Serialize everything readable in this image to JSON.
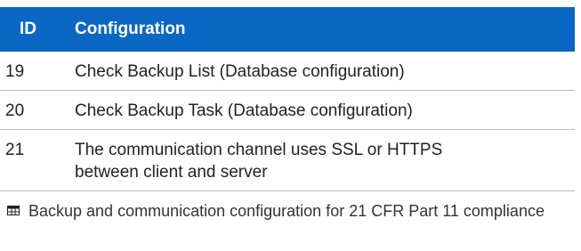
{
  "table": {
    "header": {
      "id_label": "ID",
      "config_label": "Configuration"
    },
    "rows": [
      {
        "id": "19",
        "configuration": "Check Backup List (Database configuration)"
      },
      {
        "id": "20",
        "configuration": "Check Backup Task (Database configuration)"
      },
      {
        "id": "21",
        "configuration": "The communication channel uses SSL or HTTPS between client and server"
      }
    ]
  },
  "caption": {
    "icon": "table-icon",
    "text": "Backup and communication configuration for 21 CFR Part 11 compliance"
  },
  "colors": {
    "header_background": "#0b67c4",
    "header_text": "#ffffff",
    "row_divider": "#bdbdbd",
    "body_text": "#222222"
  }
}
